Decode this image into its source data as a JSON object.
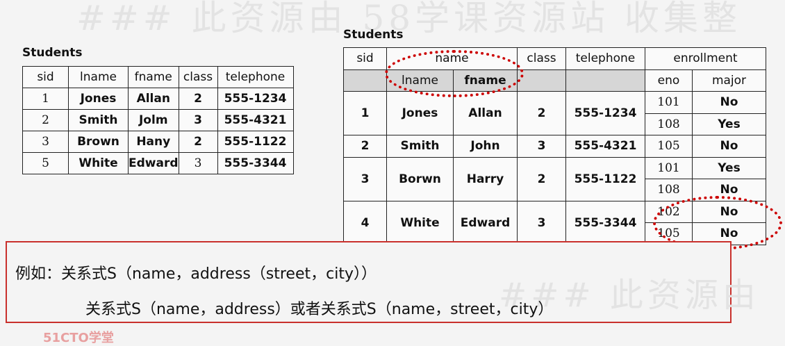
{
  "watermark": {
    "top": "### 此资源由 58学课资源站 收集整",
    "bottom": "### 此资源由"
  },
  "left_table": {
    "caption": "Students",
    "headers": [
      "sid",
      "lname",
      "fname",
      "class",
      "telephone"
    ],
    "rows": [
      [
        "1",
        "Jones",
        "Allan",
        "2",
        "555-1234"
      ],
      [
        "2",
        "Smith",
        "Jolm",
        "3",
        "555-4321"
      ],
      [
        "3",
        "Brown",
        "Hany",
        "2",
        "555-1122"
      ],
      [
        "5",
        "White",
        "Edward",
        "3",
        "555-3344"
      ]
    ]
  },
  "right_table": {
    "caption": "Students",
    "headers": {
      "sid": "sid",
      "name": "name",
      "class": "class",
      "telephone": "telephone",
      "enrollment": "enrollment",
      "lname": "lname",
      "fname": "fname",
      "eno": "eno",
      "major": "major"
    },
    "students": [
      {
        "sid": "1",
        "lname": "Jones",
        "fname": "Allan",
        "class": "2",
        "telephone": "555-1234",
        "enrollment": [
          [
            "101",
            "No"
          ],
          [
            "108",
            "Yes"
          ]
        ]
      },
      {
        "sid": "2",
        "lname": "Smith",
        "fname": "John",
        "class": "3",
        "telephone": "555-4321",
        "enrollment": [
          [
            "105",
            "No"
          ]
        ]
      },
      {
        "sid": "3",
        "lname": "Borwn",
        "fname": "Harry",
        "class": "2",
        "telephone": "555-1122",
        "enrollment": [
          [
            "101",
            "Yes"
          ],
          [
            "108",
            "No"
          ]
        ]
      },
      {
        "sid": "4",
        "lname": "White",
        "fname": "Edward",
        "class": "3",
        "telephone": "555-3344",
        "enrollment": [
          [
            "102",
            "No"
          ],
          [
            "105",
            "No"
          ]
        ]
      }
    ]
  },
  "note": {
    "line1": "例如：关系式S（name，address（street，city））",
    "line2": "关系式S（name，address）或者关系式S（name，street，city）"
  },
  "logo": "51CTO学堂",
  "colors": {
    "highlight": "#cc0000",
    "box_border": "#c9302c"
  }
}
